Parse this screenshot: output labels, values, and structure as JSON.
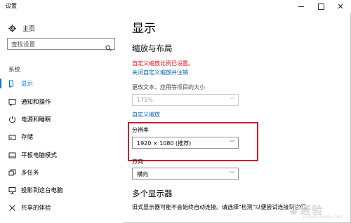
{
  "window": {
    "title": "设置"
  },
  "sidebar": {
    "home_label": "主页",
    "search_placeholder": "查找设置",
    "section_label": "系统",
    "items": [
      {
        "label": "显示",
        "icon": "monitor-icon",
        "selected": true
      },
      {
        "label": "通知和操作",
        "icon": "notification-icon",
        "selected": false
      },
      {
        "label": "电源和睡眠",
        "icon": "power-icon",
        "selected": false
      },
      {
        "label": "存储",
        "icon": "storage-icon",
        "selected": false
      },
      {
        "label": "平板电脑模式",
        "icon": "tablet-icon",
        "selected": false
      },
      {
        "label": "多任务",
        "icon": "multitask-icon",
        "selected": false
      },
      {
        "label": "投影到这台电脑",
        "icon": "projection-icon",
        "selected": false
      },
      {
        "label": "共享的体验",
        "icon": "share-icon",
        "selected": false
      }
    ]
  },
  "main": {
    "page_title": "显示",
    "scale_section": {
      "heading": "缩放与布局",
      "warning": "自定义缩放比例已设置。",
      "turn_off_link": "关闭自定义缩放并注销",
      "text_size_label": "更改文本、应用等项目的大小",
      "text_size_value": "175%",
      "custom_scale_link": "自定义缩放",
      "resolution_label": "分辨率",
      "resolution_value": "1920 × 1080 (推荐)",
      "orientation_label": "方向",
      "orientation_value": "横向"
    },
    "multi_display": {
      "heading": "多个显示器",
      "body": "旧式显示器可能不会始终自动连接。请选择\"检测\"以便尝试连接到它们。"
    }
  },
  "watermark": {
    "text": "经验",
    "sub": "jingyan.baidu.com"
  },
  "colors": {
    "accent": "#0078d7",
    "link": "#0066b4",
    "warning": "#e81123",
    "highlight_box": "#d2182d"
  }
}
